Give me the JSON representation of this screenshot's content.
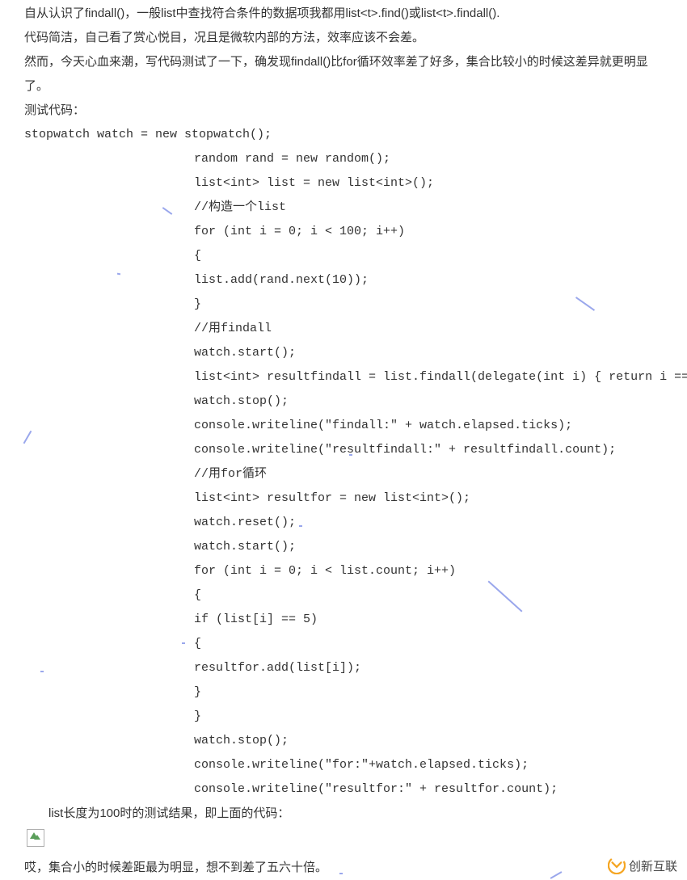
{
  "intro": {
    "p1": "自从认识了findall()，一般list中查找符合条件的数据项我都用list<t>.find()或list<t>.findall().",
    "p2": "代码简洁，自己看了赏心悦目，况且是微软内部的方法，效率应该不会差。",
    "p3": "然而，今天心血来潮，写代码测试了一下，确发现findall()比for循环效率差了好多，集合比较小的时候这差异就更明显了。",
    "p4": "测试代码："
  },
  "code": {
    "l00": "stopwatch watch = new stopwatch();",
    "l01": "random rand = new random();",
    "l02": "list<int> list = new list<int>();",
    "l03": "//构造一个list",
    "l04": "for (int i = 0; i < 100; i++)",
    "l05": "{",
    "l06": "    list.add(rand.next(10));",
    "l07": "}",
    "l08": "//用findall",
    "l09": "watch.start();",
    "l10": "list<int> resultfindall = list.findall(delegate(int i) { return i ==",
    "l11": "watch.stop();",
    "l12": "console.writeline(\"findall:\" + watch.elapsed.ticks);",
    "l13": "console.writeline(\"resultfindall:\" + resultfindall.count);",
    "l14": "//用for循环",
    "l15": "list<int> resultfor = new list<int>();",
    "l16": "watch.reset();",
    "l17": "watch.start();",
    "l18": "for (int i = 0; i < list.count; i++)",
    "l19": "{",
    "l20": "    if (list[i] == 5)",
    "l21": "    {",
    "l22": "        resultfor.add(list[i]);",
    "l23": "    }",
    "l24": "}",
    "l25": "watch.stop();",
    "l26": "console.writeline(\"for:\"+watch.elapsed.ticks);",
    "l27": "console.writeline(\"resultfor:\" + resultfor.count);"
  },
  "result_label": "list长度为100时的测试结果，即上面的代码：",
  "conclusion": "哎，集合小的时候差距最为明显，想不到差了五六十倍。",
  "brand": {
    "text": "创新互联"
  }
}
